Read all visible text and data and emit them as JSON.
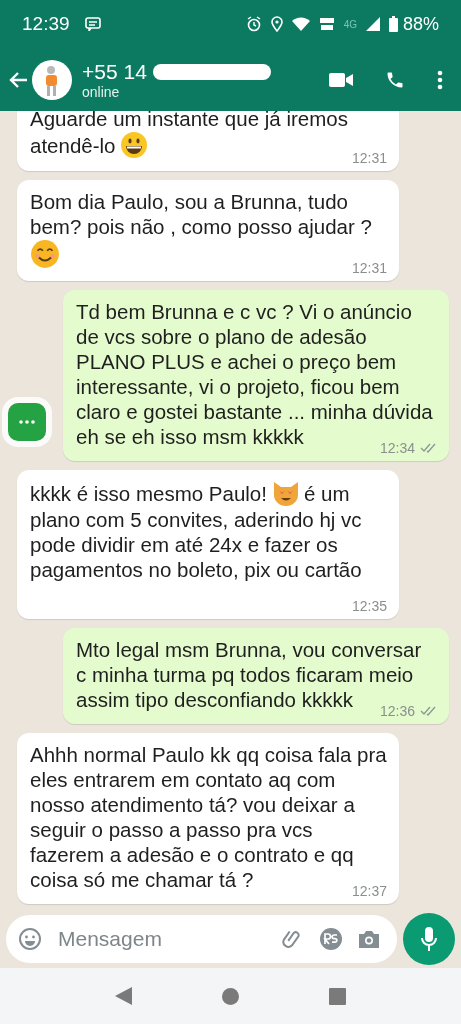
{
  "status_bar": {
    "time": "12:39",
    "network": "4G",
    "battery": "88%"
  },
  "header": {
    "number": "+55 14",
    "status": "online"
  },
  "messages": [
    {
      "kind": "incoming",
      "segments": [
        {
          "kind": "line",
          "text": "Aguarde um instante que já iremos"
        },
        {
          "kind": "text",
          "text": "atendê-lo"
        },
        {
          "kind": "grin"
        }
      ],
      "time": "12:31"
    },
    {
      "kind": "incoming",
      "segments": [
        {
          "kind": "text",
          "text": "Bom dia Paulo, sou a Brunna, tudo bem? pois não , como posso ajudar ?"
        },
        {
          "kind": "smile"
        }
      ],
      "time": "12:31"
    },
    {
      "kind": "outgoing",
      "segments": [
        {
          "kind": "text",
          "text": "Td bem Brunna e c vc ? Vi o anúncio de vcs sobre o plano de adesão PLANO PLUS e achei o preço bem interessante, vi o projeto, ficou bem claro e gostei bastante ... minha dúvida eh se eh isso msm kkkkk"
        }
      ],
      "time": "12:34",
      "read": false
    },
    {
      "kind": "incoming",
      "segments": [
        {
          "kind": "text",
          "text": "kkkk é isso mesmo Paulo!"
        },
        {
          "kind": "cat"
        },
        {
          "kind": "text",
          "text": "é um"
        },
        {
          "kind": "line",
          "text": "plano com 5 convites, aderindo hj vc pode dividir em até 24x e fazer os pagamentos no boleto, pix ou cartão"
        }
      ],
      "time": "12:35"
    },
    {
      "kind": "outgoing",
      "segments": [
        {
          "kind": "text",
          "text": "Mto legal msm Brunna, vou conversar c minha turma pq todos ficaram meio assim tipo desconfiando kkkkk"
        }
      ],
      "time": "12:36",
      "read": false
    },
    {
      "kind": "incoming",
      "segments": [
        {
          "kind": "text",
          "text": "Ahhh normal Paulo kk qq coisa fala pra eles entrarem em contato aq com nosso atendimento tá? vou deixar a seguir o passo a passo pra vcs fazerem a adesão e o contrato e qq coisa só me chamar tá ?"
        }
      ],
      "time": "12:37"
    }
  ],
  "composer": {
    "placeholder": "Mensagem"
  }
}
